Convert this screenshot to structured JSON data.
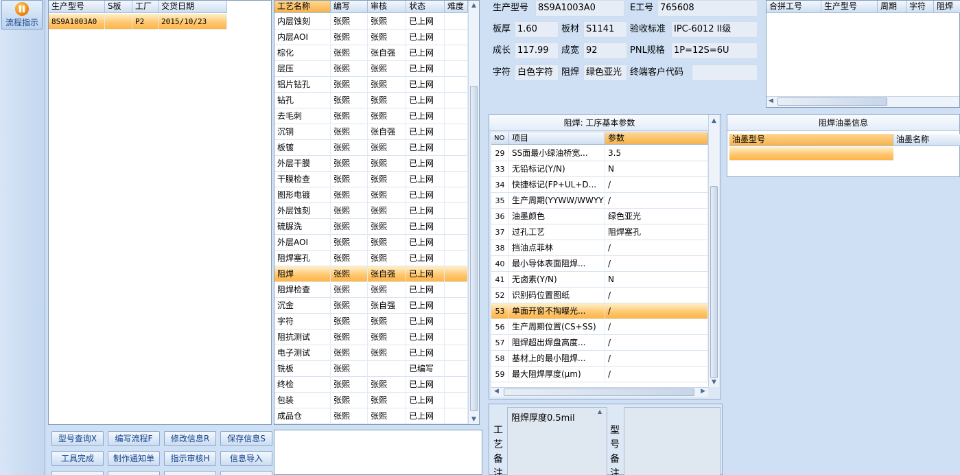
{
  "sidebar": {
    "flow_button": "流程指示"
  },
  "models_grid": {
    "columns": [
      "生产型号",
      "S板",
      "工厂",
      "交货日期"
    ],
    "rows": [
      [
        "8S9A1003A0",
        "",
        "P2",
        "2015/10/23"
      ]
    ]
  },
  "process_grid": {
    "columns": [
      "工艺名称",
      "编写",
      "审核",
      "状态",
      "难度"
    ],
    "rows": [
      [
        "内层蚀刻",
        "张熙",
        "张熙",
        "已上网",
        ""
      ],
      [
        "内层AOI",
        "张熙",
        "张熙",
        "已上网",
        ""
      ],
      [
        "棕化",
        "张熙",
        "张自强",
        "已上网",
        ""
      ],
      [
        "层压",
        "张熙",
        "张熙",
        "已上网",
        ""
      ],
      [
        "铝片钻孔",
        "张熙",
        "张熙",
        "已上网",
        ""
      ],
      [
        "钻孔",
        "张熙",
        "张熙",
        "已上网",
        ""
      ],
      [
        "去毛刺",
        "张熙",
        "张熙",
        "已上网",
        ""
      ],
      [
        "沉铜",
        "张熙",
        "张自强",
        "已上网",
        ""
      ],
      [
        "板镀",
        "张熙",
        "张熙",
        "已上网",
        ""
      ],
      [
        "外层干膜",
        "张熙",
        "张熙",
        "已上网",
        ""
      ],
      [
        "干膜检查",
        "张熙",
        "张熙",
        "已上网",
        ""
      ],
      [
        "图形电镀",
        "张熙",
        "张熙",
        "已上网",
        ""
      ],
      [
        "外层蚀刻",
        "张熙",
        "张熙",
        "已上网",
        ""
      ],
      [
        "硫脲洗",
        "张熙",
        "张熙",
        "已上网",
        ""
      ],
      [
        "外层AOI",
        "张熙",
        "张熙",
        "已上网",
        ""
      ],
      [
        "阻焊塞孔",
        "张熙",
        "张熙",
        "已上网",
        ""
      ],
      [
        "阻焊",
        "张熙",
        "张自强",
        "已上网",
        ""
      ],
      [
        "阻焊检查",
        "张熙",
        "张熙",
        "已上网",
        ""
      ],
      [
        "沉金",
        "张熙",
        "张自强",
        "已上网",
        ""
      ],
      [
        "字符",
        "张熙",
        "张熙",
        "已上网",
        ""
      ],
      [
        "阻抗测试",
        "张熙",
        "张熙",
        "已上网",
        ""
      ],
      [
        "电子测试",
        "张熙",
        "张熙",
        "已上网",
        ""
      ],
      [
        "铣板",
        "张熙",
        "",
        "已编写",
        ""
      ],
      [
        "终检",
        "张熙",
        "张熙",
        "已上网",
        ""
      ],
      [
        "包装",
        "张熙",
        "张熙",
        "已上网",
        ""
      ],
      [
        "成品仓",
        "张熙",
        "张熙",
        "已上网",
        ""
      ]
    ],
    "selected_index": 16
  },
  "buttons": {
    "row1": [
      "型号查询X",
      "编写流程F",
      "修改信息R",
      "保存信息S"
    ],
    "row2": [
      "工具完成",
      "制作通知单",
      "指示审核H",
      "信息导入"
    ]
  },
  "info": {
    "model_label": "生产型号",
    "model_value": "8S9A1003A0",
    "eng_label": "E工号",
    "eng_value": "765608",
    "thick_label": "板厚",
    "thick_value": "1.60",
    "material_label": "板材",
    "material_value": "S1141",
    "accept_label": "验收标准",
    "accept_value": "IPC-6012 II级",
    "length_label": "成长",
    "length_value": "117.99",
    "width_label": "成宽",
    "width_value": "92",
    "pnl_label": "PNL规格",
    "pnl_value": "1P=12S=6U",
    "char_label": "字符",
    "char_value": "白色字符",
    "mask_label": "阻焊",
    "mask_value": "绿色亚光",
    "customer_label": "终端客户代码",
    "customer_value": ""
  },
  "combine_grid": {
    "columns": [
      "合拼工号",
      "生产型号",
      "周期",
      "字符",
      "阻焊"
    ]
  },
  "params_panel": {
    "title": "阻焊: 工序基本参数",
    "columns": [
      "NO",
      "项目",
      "参数"
    ],
    "rows": [
      [
        "29",
        "SS面最小绿油桥宽...",
        "3.5"
      ],
      [
        "33",
        "无铅标记(Y/N)",
        "N"
      ],
      [
        "34",
        "快捷标记(FP+UL+D...",
        "/"
      ],
      [
        "35",
        "生产周期(YYWW/WWYY)",
        "/"
      ],
      [
        "36",
        "油墨颜色",
        "绿色亚光"
      ],
      [
        "37",
        "过孔工艺",
        "阻焊塞孔"
      ],
      [
        "38",
        "挡油点菲林",
        "/"
      ],
      [
        "40",
        "最小导体表面阻焊...",
        "/"
      ],
      [
        "41",
        "无卤素(Y/N)",
        "N"
      ],
      [
        "52",
        "识别码位置图纸",
        "/"
      ],
      [
        "53",
        "单面开窗不掏曝光...",
        "/"
      ],
      [
        "56",
        "生产周期位置(CS+SS)",
        "/"
      ],
      [
        "57",
        "阻焊超出焊盘高度...",
        "/"
      ],
      [
        "58",
        "基材上的最小阻焊...",
        "/"
      ],
      [
        "59",
        "最大阻焊厚度(μm)",
        "/"
      ]
    ],
    "selected_index": 10
  },
  "ink_panel": {
    "title": "阻焊油墨信息",
    "columns": [
      "油墨型号",
      "油墨名称"
    ]
  },
  "memo": {
    "process_label": "工艺备注",
    "process_text": "阻焊厚度0.5mil",
    "model_label": "型号备注",
    "model_text": ""
  }
}
